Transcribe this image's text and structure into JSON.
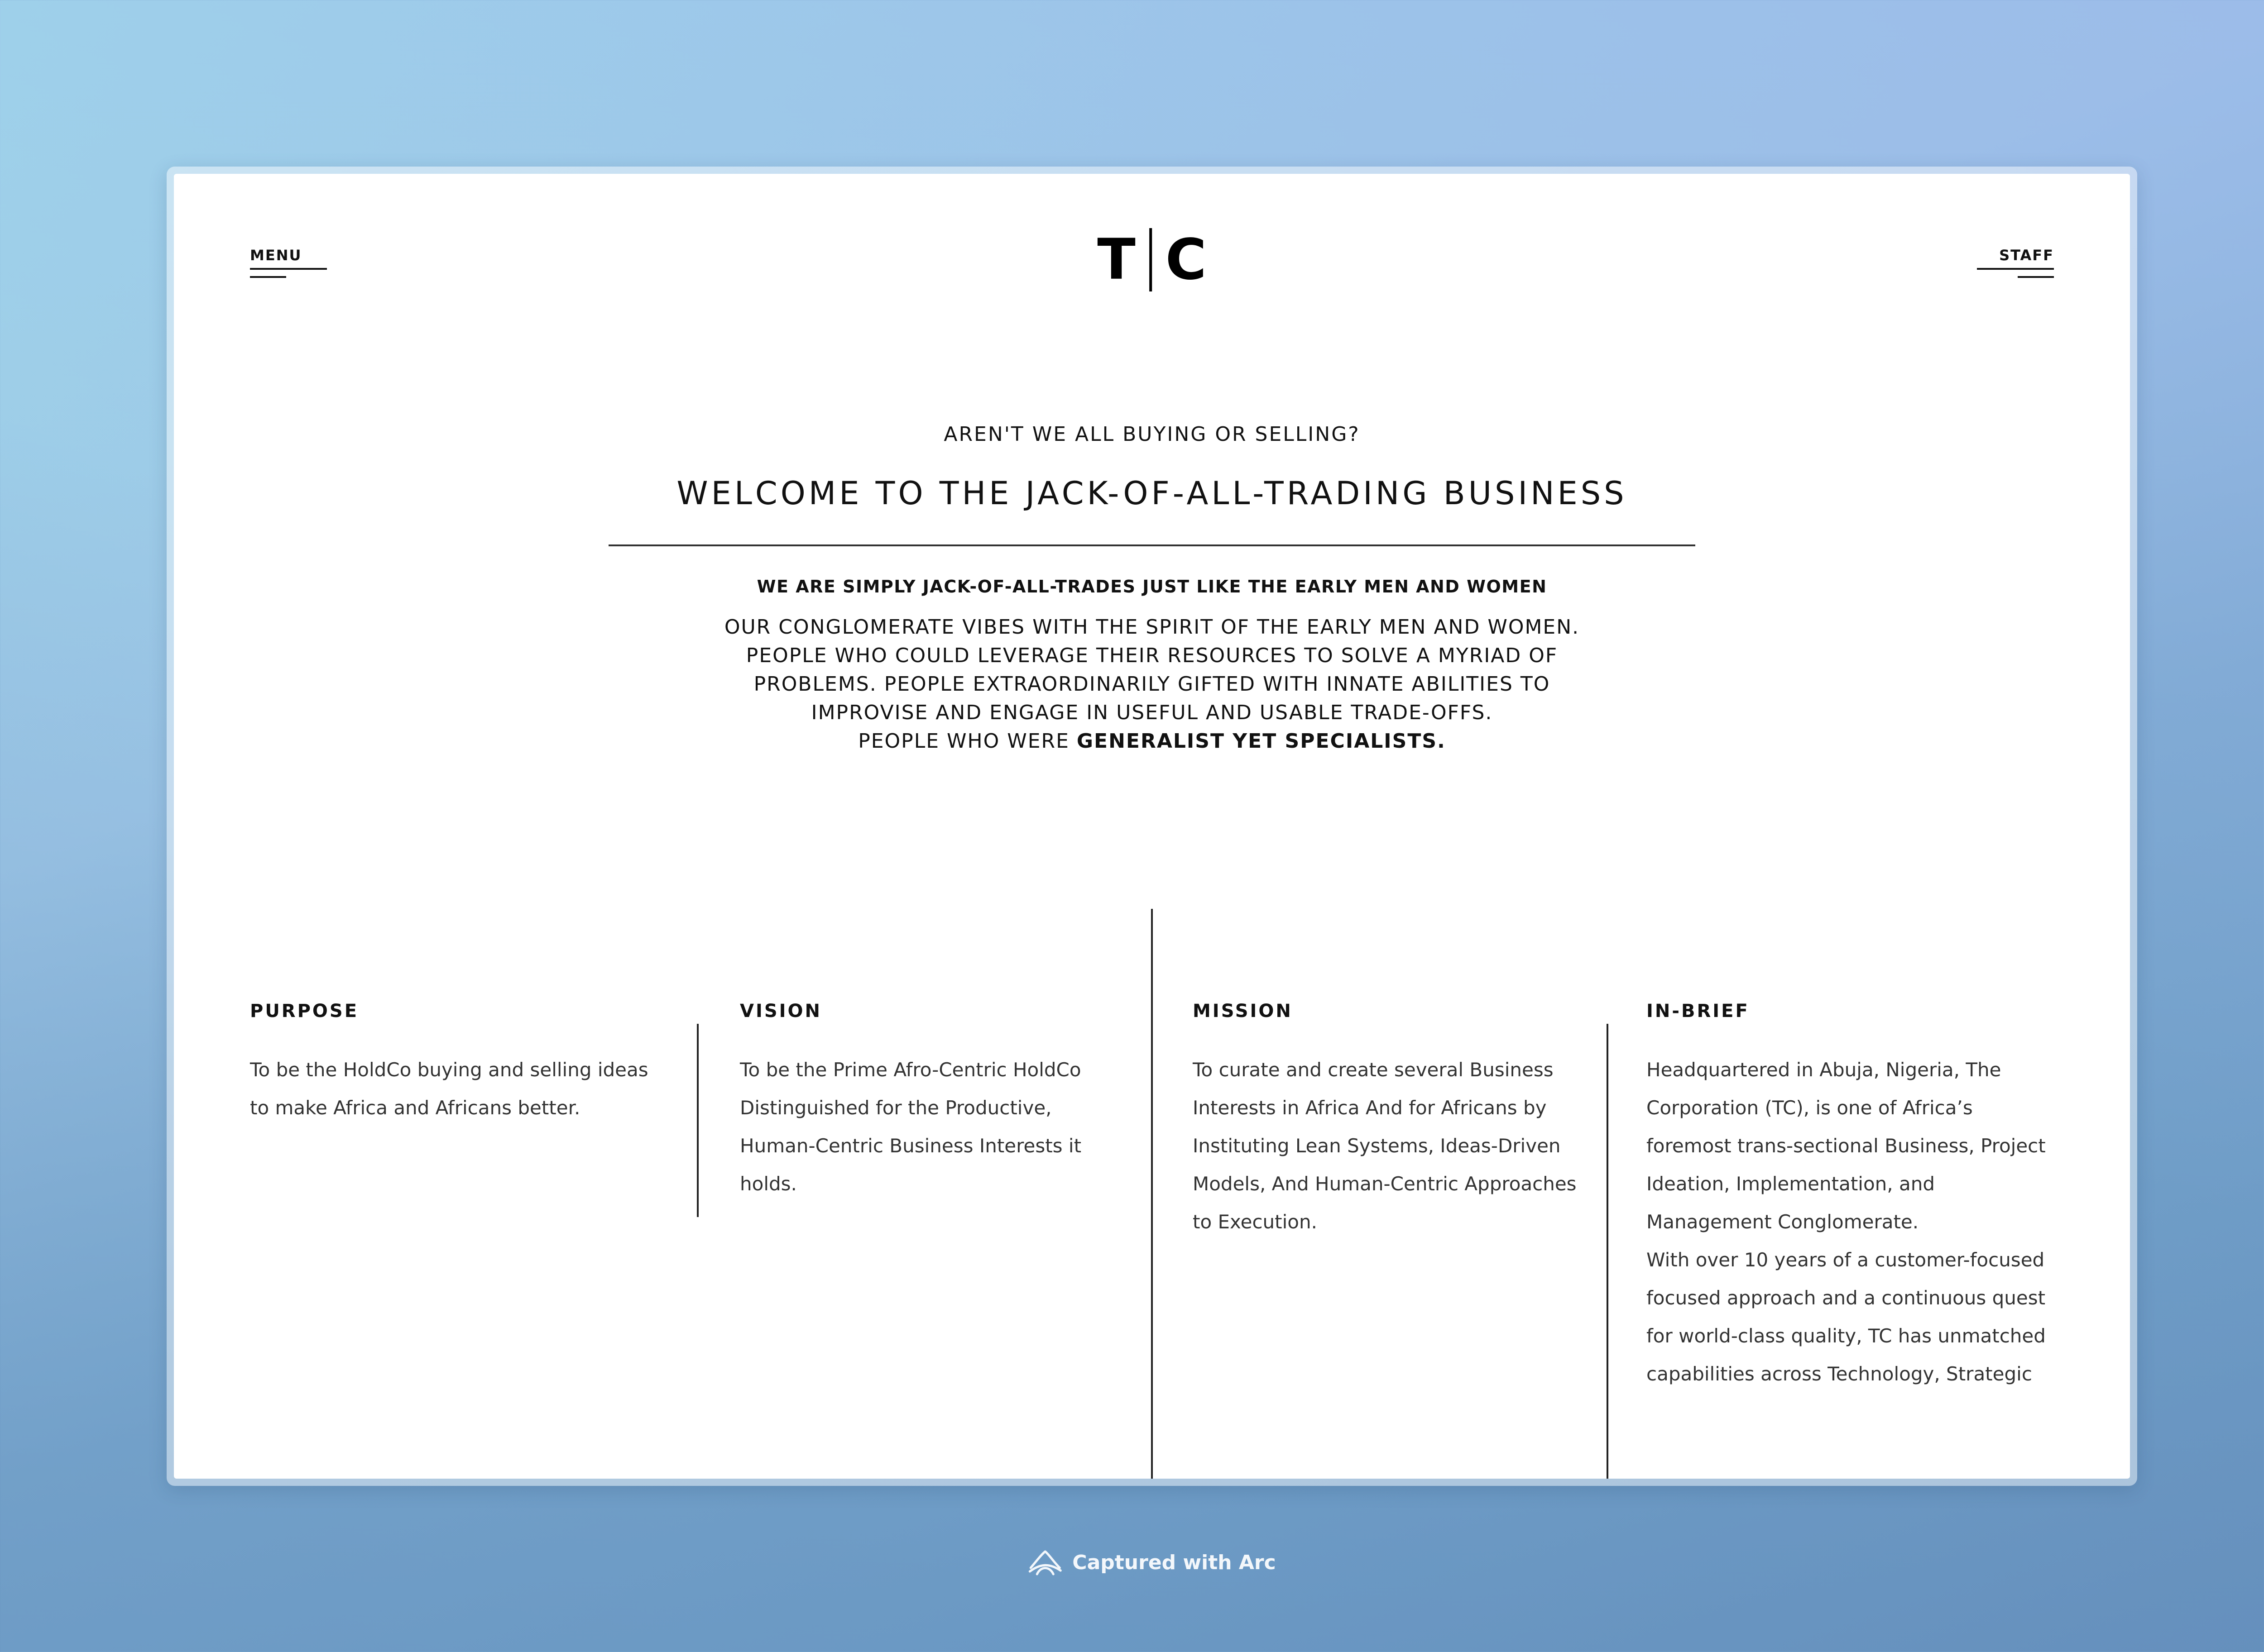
{
  "header": {
    "menu_label": "MENU",
    "staff_label": "STAFF",
    "logo": {
      "left": "T",
      "right": "C"
    }
  },
  "hero": {
    "eyebrow": "AREN'T WE ALL BUYING OR SELLING?",
    "headline": "WELCOME TO THE JACK-OF-ALL-TRADING BUSINESS",
    "subhead": "WE ARE SIMPLY JACK-OF-ALL-TRADES JUST LIKE THE EARLY MEN AND WOMEN",
    "body_lines": [
      "OUR CONGLOMERATE VIBES WITH THE SPIRIT OF THE EARLY MEN AND WOMEN.",
      "PEOPLE WHO COULD LEVERAGE THEIR RESOURCES TO SOLVE A MYRIAD OF",
      "PROBLEMS. PEOPLE EXTRAORDINARILY GIFTED WITH INNATE ABILITIES TO",
      "IMPROVISE AND ENGAGE IN USEFUL AND USABLE TRADE-OFFS."
    ],
    "body_last_prefix": "PEOPLE WHO WERE ",
    "body_last_bold": "GENERALIST YET SPECIALISTS."
  },
  "sections": {
    "purpose": {
      "title": "PURPOSE",
      "body": "To be the HoldCo buying and selling ideas to make Africa and Africans better."
    },
    "vision": {
      "title": "VISION",
      "body": "To be the Prime Afro-Centric HoldCo Distinguished for the Productive, Human-Centric Business Interests it holds."
    },
    "mission": {
      "title": "MISSION",
      "body": "To curate and create several Business Interests in Africa And for Africans by Instituting Lean Systems, Ideas-Driven Models, And Human-Centric Approaches to Execution."
    },
    "inbrief": {
      "title": "IN-BRIEF",
      "body_1": "Headquartered in Abuja, Nigeria, The Corporation (TC), is one of Africa’s foremost trans-sectional Business, Project Ideation, Implementation, and Management Conglomerate.",
      "body_2": "With over 10 years of a customer-focused focused approach and a continuous quest for world-class quality, TC has unmatched capabilities across Technology, Strategic"
    }
  },
  "footer": {
    "arc_label": "Captured with Arc"
  }
}
